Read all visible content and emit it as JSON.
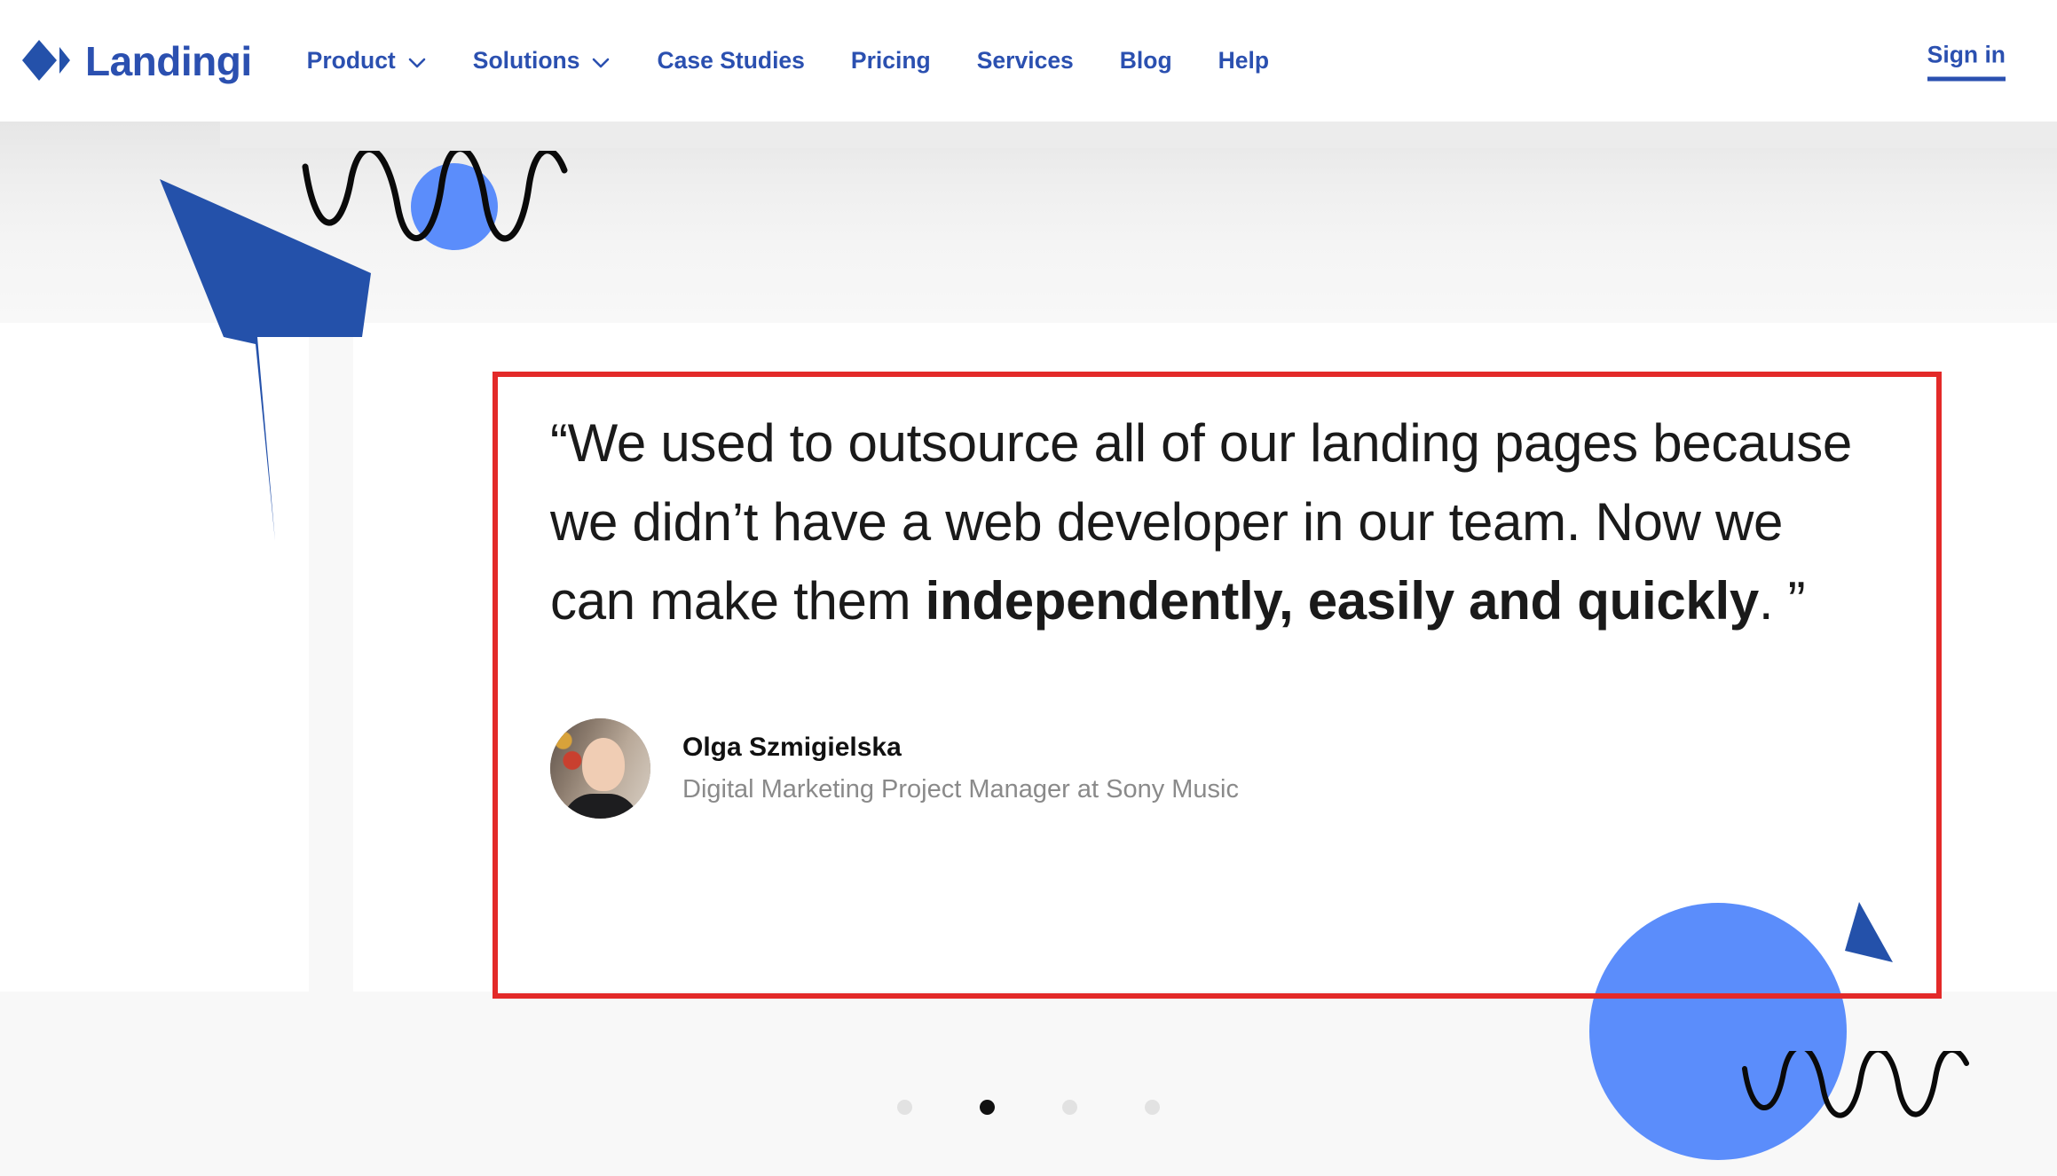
{
  "header": {
    "logo": {
      "mark_icon": "landingi-diamond-logo-icon",
      "text": "Landingi"
    },
    "nav_items": [
      {
        "label": "Product",
        "has_dropdown": true,
        "dropdown_icon": "chevron-down-icon"
      },
      {
        "label": "Solutions",
        "has_dropdown": true,
        "dropdown_icon": "chevron-down-icon"
      },
      {
        "label": "Case Studies",
        "has_dropdown": false
      },
      {
        "label": "Pricing",
        "has_dropdown": false
      },
      {
        "label": "Services",
        "has_dropdown": false
      },
      {
        "label": "Blog",
        "has_dropdown": false
      },
      {
        "label": "Help",
        "has_dropdown": false
      }
    ],
    "sign_in": "Sign in"
  },
  "testimonial": {
    "quote_part_1": "“We used to outsource all of our landing pages because we didn’t have a web developer in our team. Now we can make them ",
    "quote_bold": "independently, easily and quickly",
    "quote_part_2": ". ”",
    "author_name": "Olga Szmigielska",
    "author_role": "Digital Marketing Project Manager at Sony Music",
    "avatar_icon": "author-avatar-photo"
  },
  "carousel": {
    "dots": [
      {
        "active": false
      },
      {
        "active": true
      },
      {
        "active": false
      },
      {
        "active": false
      }
    ],
    "active_index": 1,
    "total": 4
  },
  "annotation": {
    "box_color": "#e32a29",
    "label": "highlight-box"
  },
  "decorations": [
    {
      "name": "arrow-shape-top-left",
      "color": "#2451aa"
    },
    {
      "name": "circle-top-left",
      "color": "#5b8dfb"
    },
    {
      "name": "squiggle-top-left",
      "color": "#000000"
    },
    {
      "name": "circle-bottom-right",
      "color": "#5b8dfb"
    },
    {
      "name": "triangle-bottom-right",
      "color": "#2451aa"
    },
    {
      "name": "squiggle-bottom-right",
      "color": "#000000"
    }
  ],
  "colors": {
    "brand_blue": "#2b50b0",
    "accent_blue": "#5b8dfb",
    "deep_blue": "#2451aa",
    "annotation_red": "#e32a29",
    "text_dark": "#1a1a1a",
    "text_muted": "#8a8a8a",
    "bg_gray": "#f8f8f8"
  }
}
